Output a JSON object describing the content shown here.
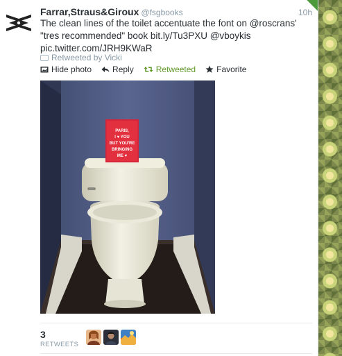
{
  "tweet": {
    "display_name": "Farrar,Straus&Giroux",
    "handle": "@fsgbooks",
    "time": "10h",
    "text_main": "The clean lines of the toilet accentuate the font on @roscrans' \"tres recommended\" book ",
    "link1": "bit.ly/Tu3PXU",
    "mention": "@vboykis",
    "link2": "pic.twitter.com/JRH9KWaR",
    "retweeted_by": "Retweeted by Vicki",
    "actions": {
      "hide_photo": "Hide photo",
      "reply": "Reply",
      "retweeted": "Retweeted",
      "favorite": "Favorite"
    },
    "photo": {
      "book_text": [
        "PARIS,",
        "I ♥ YOU",
        "BUT YOU'RE",
        "BRINGING",
        "ME ♥"
      ]
    },
    "stats": {
      "retweet_count": "3",
      "retweet_label": "RETWEETS"
    }
  },
  "colors": {
    "retweeted_green": "#609928",
    "meta_gray": "#8899a6",
    "text_dark": "#292f33"
  },
  "icons": {
    "avatar": "fsg-logo-icon",
    "retweeted_by": "retweet-small-icon",
    "hide_photo": "photo-icon",
    "reply": "reply-arrow-icon",
    "retweet": "retweet-icon",
    "favorite": "star-icon"
  }
}
